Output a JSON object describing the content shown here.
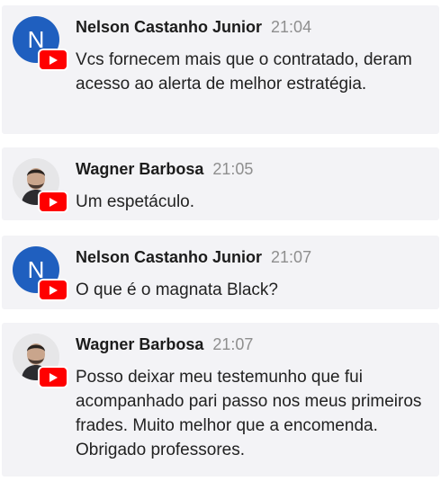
{
  "colors": {
    "card_bg": "#f3f3f6",
    "avatar_blue": "#1f5fbf",
    "youtube_red": "#ff0000",
    "timestamp_gray": "#8e8e8e"
  },
  "messages": [
    {
      "avatar_initial": "N",
      "avatar_type": "initial",
      "badge_icon": "youtube-icon",
      "author": "Nelson Castanho Junior",
      "time": "21:04",
      "text": "Vcs fornecem mais que o contratado, deram acesso ao alerta de melhor estratégia."
    },
    {
      "avatar_type": "photo",
      "badge_icon": "youtube-icon",
      "author": "Wagner Barbosa",
      "time": "21:05",
      "text": "Um espetáculo."
    },
    {
      "avatar_initial": "N",
      "avatar_type": "initial",
      "badge_icon": "youtube-icon",
      "author": "Nelson Castanho Junior",
      "time": "21:07",
      "text": "O que é o magnata Black?"
    },
    {
      "avatar_type": "photo",
      "badge_icon": "youtube-icon",
      "author": "Wagner Barbosa",
      "time": "21:07",
      "text": "Posso deixar meu testemunho que fui acompanhado pari passo nos meus primeiros frades. Muito melhor que a encomenda. Obrigado professores."
    }
  ]
}
